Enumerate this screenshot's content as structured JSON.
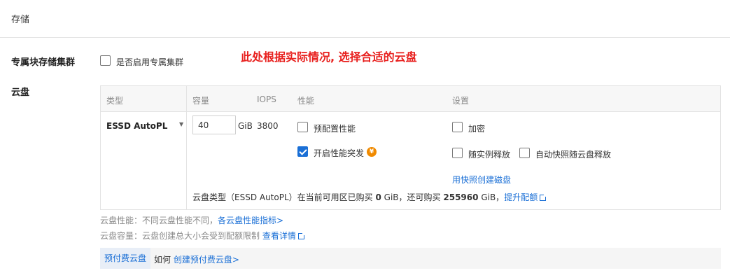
{
  "page_title": "存储",
  "annotation": "此处根据实际情况, 选择合适的云盘",
  "dedicated": {
    "label": "专属块存储集群",
    "checkbox_label": "是否启用专属集群",
    "checked": false
  },
  "cloud_disk": {
    "label": "云盘",
    "headers": {
      "type": "类型",
      "capacity": "容量",
      "iops": "IOPS",
      "performance": "性能",
      "settings": "设置"
    },
    "row": {
      "type_value": "ESSD AutoPL",
      "capacity_value": "40",
      "capacity_unit": "GiB",
      "iops_value": "3800",
      "options": {
        "provisioned": "预配置性能",
        "burst": "开启性能突发",
        "encrypt": "加密",
        "release_with_instance": "随实例释放",
        "auto_snapshot_release": "自动快照随云盘释放",
        "create_from_snapshot": "用快照创建磁盘"
      },
      "quota_line": {
        "prefix": "云盘类型（ESSD AutoPL）在当前可用区已购买",
        "bought": "0",
        "mid": "GiB，还可购买",
        "available": "255960",
        "suffix": "GiB，",
        "link": "提升配额"
      }
    }
  },
  "hints": {
    "perf_text": "云盘性能：不同云盘性能不同，",
    "perf_link": "各云盘性能指标>",
    "cap_text": "云盘容量：云盘创建总大小会受到配额限制",
    "cap_link": "查看详情"
  },
  "prepay": {
    "tab": "预付费云盘",
    "text": "如何",
    "link": "创建预付费云盘>"
  },
  "icons": {
    "coin": "¥"
  },
  "colors": {
    "accent": "#1a6fd6",
    "annotation": "#e8201e",
    "coin": "#f08a00"
  }
}
